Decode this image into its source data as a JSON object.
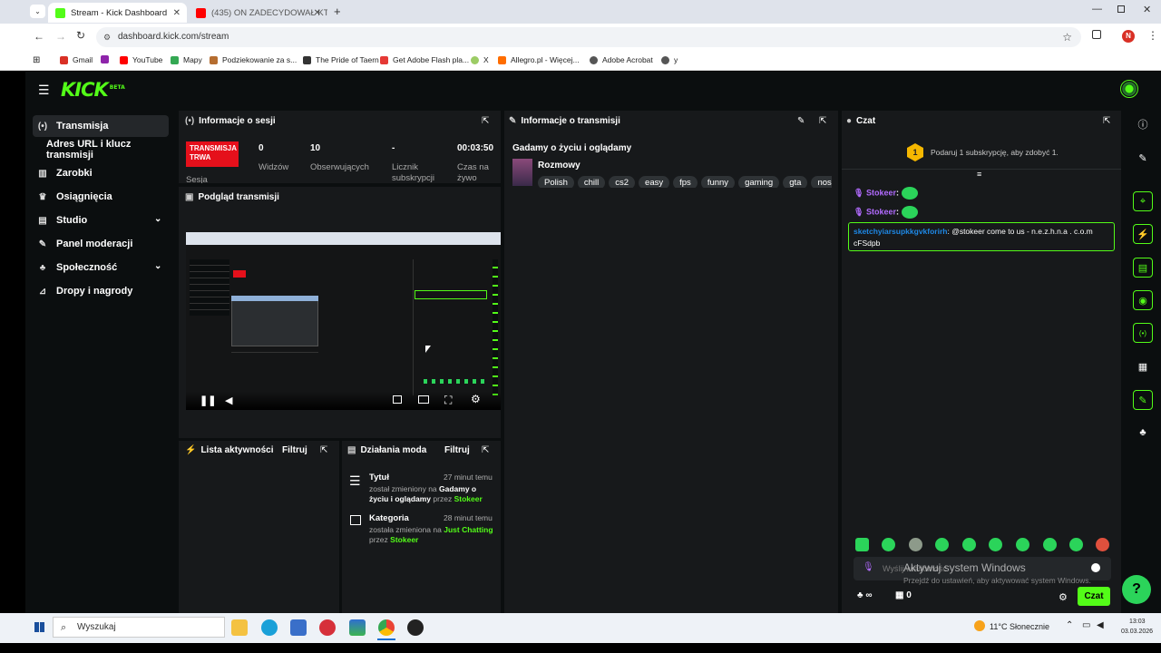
{
  "browser": {
    "tabs": [
      {
        "title": "Stream - Kick Dashboard",
        "active": true,
        "favicon_color": "#53fc18"
      },
      {
        "title": "(435) ON ZADECYDOWAŁ KTO",
        "active": false,
        "favicon_color": "#ff0000"
      }
    ],
    "url": "dashboard.kick.com/stream",
    "profile_initial": "N",
    "bookmarks": [
      "Gmail",
      "YouTube",
      "Mapy",
      "Podziekowanie za s...",
      "The Pride of Taern",
      "Get Adobe Flash pla...",
      "X",
      "Allegro.pl - Więcej...",
      "Adobe Acrobat",
      "y"
    ]
  },
  "kick": {
    "logo": "KICK",
    "logo_badge": "BETA",
    "accent": "#53fc18",
    "sidebar": [
      {
        "label": "Transmisja",
        "icon": "broadcast-icon",
        "active": true
      },
      {
        "label": "Adres URL i klucz transmisji",
        "icon": "",
        "sub": true
      },
      {
        "label": "Zarobki",
        "icon": "earnings-icon"
      },
      {
        "label": "Osiągnięcia",
        "icon": "trophy-icon"
      },
      {
        "label": "Studio",
        "icon": "studio-icon",
        "chevron": true
      },
      {
        "label": "Panel moderacji",
        "icon": "wrench-icon"
      },
      {
        "label": "Społeczność",
        "icon": "community-icon",
        "chevron": true
      },
      {
        "label": "Dropy i nagrody",
        "icon": "drops-icon"
      }
    ],
    "session": {
      "title": "Informacje o sesji",
      "live_badge": "TRANSMISJA TRWA",
      "live_sub": "Sesja",
      "stats": [
        {
          "value": "0",
          "label": "Widzów"
        },
        {
          "value": "10",
          "label": "Obserwujących"
        },
        {
          "value": "-",
          "label": "Licznik subskrypcji"
        },
        {
          "value": "00:03:50",
          "label": "Czas na żywo"
        }
      ]
    },
    "preview": {
      "title": "Podgląd transmisji"
    },
    "stream_info": {
      "title": "Informacje o transmisji",
      "stream_title": "Gadamy o życiu i oglądamy",
      "category": "Rozmowy",
      "tags": [
        "Polish",
        "chill",
        "cs2",
        "easy",
        "fps",
        "funny",
        "gaming",
        "gta",
        "nosch"
      ]
    },
    "activity": {
      "title": "Lista aktywności",
      "filter": "Filtruj"
    },
    "mod_actions": {
      "title": "Działania moda",
      "filter": "Filtruj",
      "items": [
        {
          "heading": "Tytuł",
          "time": "27 minut temu",
          "text_a": "został zmieniony na",
          "value_a": "Gadamy o",
          "text_b": "życiu i oglądamy",
          "by": "przez",
          "user": "Stokeer"
        },
        {
          "heading": "Kategoria",
          "time": "28 minut temu",
          "text_a": "została zmieniona na",
          "value_a": "Just Chatting",
          "text_b": "",
          "by": "przez",
          "user": "Stokeer"
        }
      ]
    },
    "chat": {
      "title": "Czat",
      "sub_goal_count": "1",
      "sub_goal_text": "Podaruj 1 subskrypcję, aby zdobyć 1.",
      "messages": [
        {
          "user": "Stokeer",
          "text": ""
        },
        {
          "user": "Stokeer",
          "text": ""
        }
      ],
      "highlight_user": "sketchyiarsupkkgvkforirh",
      "highlight_line1": ": @stokeer come to us - n.e.z.h.n.a . c.o.m",
      "highlight_line2": "cFSdpb",
      "input_placeholder": "Wyślij wiadomość",
      "send_label": "Czat",
      "viewers_count": "0",
      "pinned_count": "0",
      "infinity": "∞",
      "user_color": "#b26bff"
    }
  },
  "watermark": {
    "line1": "Aktywuj system Windows",
    "line2": "Przejdź do ustawień, aby aktywować system Windows."
  },
  "taskbar": {
    "search": "Wyszukaj",
    "weather": "11°C  Słonecznie",
    "time": "13:03",
    "date": "03.03.2026"
  }
}
